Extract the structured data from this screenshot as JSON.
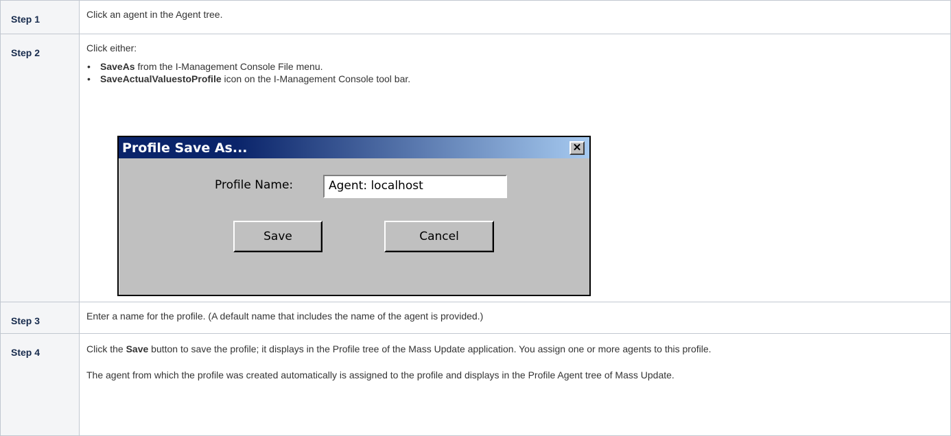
{
  "steps": [
    {
      "label": "Step 1",
      "text": "Click an agent in the Agent tree."
    },
    {
      "label": "Step 2",
      "intro": "Click either:",
      "options": [
        {
          "bold": "SaveAs",
          "rest": " from the I-Management Console File menu."
        },
        {
          "bold": "SaveActualValuestoProfile",
          "rest": " icon on the I-Management Console tool bar."
        }
      ],
      "bullet": "•"
    },
    {
      "label": "Step 3",
      "text": "Enter a name for the profile. (A default name that includes the name of the agent is provided.)"
    },
    {
      "label": "Step 4",
      "text_pre": "Click the ",
      "text_bold": "Save",
      "text_post": " button to save the profile; it displays in the Profile tree of the Mass Update application. You assign one or more agents to this profile.",
      "text2": "The agent from which the profile was created automatically is assigned to the profile and displays in the Profile Agent tree of Mass Update."
    }
  ],
  "dialog": {
    "title": "Profile Save As...",
    "close_glyph": "✕",
    "profile_name_label": "Profile Name:",
    "profile_name_value": "Agent: localhost",
    "save_label": "Save",
    "cancel_label": "Cancel"
  }
}
